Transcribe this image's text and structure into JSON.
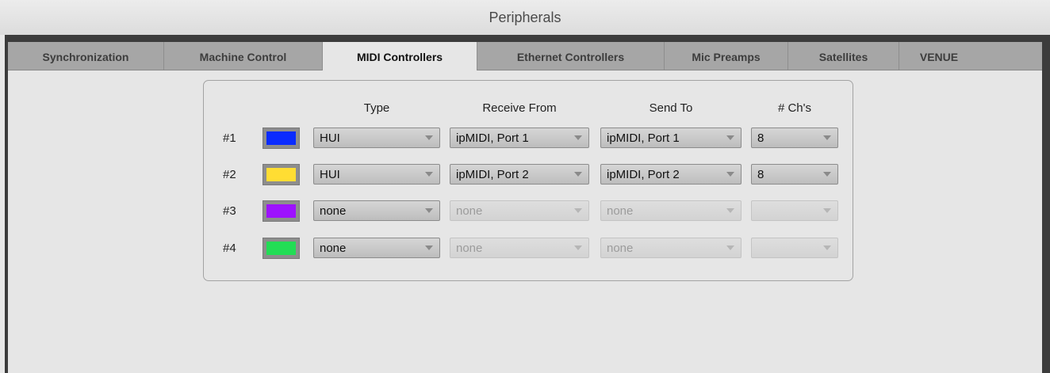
{
  "window": {
    "title": "Peripherals"
  },
  "tabs": [
    {
      "label": "Synchronization"
    },
    {
      "label": "Machine Control"
    },
    {
      "label": "MIDI Controllers"
    },
    {
      "label": "Ethernet Controllers"
    },
    {
      "label": "Mic Preamps"
    },
    {
      "label": "Satellites"
    },
    {
      "label": "VENUE"
    }
  ],
  "active_tab": "MIDI Controllers",
  "headers": {
    "type": "Type",
    "receive_from": "Receive From",
    "send_to": "Send To",
    "channels": "# Ch's"
  },
  "rows": [
    {
      "label": "#1",
      "color": "#0a2bff",
      "type": "HUI",
      "receive_from": "ipMIDI, Port 1",
      "send_to": "ipMIDI, Port 1",
      "channels": "8",
      "enabled": true
    },
    {
      "label": "#2",
      "color": "#ffdd33",
      "type": "HUI",
      "receive_from": "ipMIDI, Port 2",
      "send_to": "ipMIDI, Port 2",
      "channels": "8",
      "enabled": true
    },
    {
      "label": "#3",
      "color": "#9d12ff",
      "type": "none",
      "receive_from": "none",
      "send_to": "none",
      "channels": "",
      "enabled": false
    },
    {
      "label": "#4",
      "color": "#22dd55",
      "type": "none",
      "receive_from": "none",
      "send_to": "none",
      "channels": "",
      "enabled": false
    }
  ]
}
